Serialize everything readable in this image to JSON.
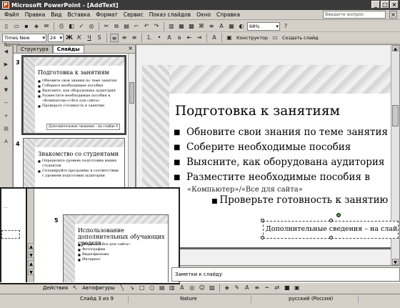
{
  "window": {
    "title": "Microsoft PowerPoint - [AddText]"
  },
  "menu": {
    "items": [
      "Файл",
      "Правка",
      "Вид",
      "Вставка",
      "Формат",
      "Сервис",
      "Показ слайдов",
      "Окно",
      "Справка"
    ],
    "help_placeholder": "Введите вопрос"
  },
  "toolbar_standard": {
    "zoom": "68%"
  },
  "toolbar_format": {
    "font": "Times New Roman",
    "size": "24",
    "designer": "Конструктор",
    "new_slide": "Создать слайд"
  },
  "pane": {
    "tabs": [
      "Структура",
      "Слайды"
    ],
    "active_tab": "Слайды"
  },
  "thumbnails": [
    {
      "num": "3",
      "title": "Подготовка к занятиям",
      "bullets": [
        "Обновите свои знания по теме занятия",
        "Соберите необходимые пособия",
        "Выясните, как оборудована аудитория",
        "Разместите необходимые пособия в «Компьютер»/«Все для сайта»",
        "Проверьте готовность к занятию"
      ],
      "note": "Дополнительные сведения – на слайде 4"
    },
    {
      "num": "4",
      "title": "Знакомство со студентами",
      "bullets": [
        "Определите уровень подготовки ваших студентов",
        "Спланируйте программу в соответствии с уровнем подготовки аудитории"
      ],
      "note": ""
    },
    {
      "num": "5",
      "title": "Использование дополнительных обучающих средств",
      "bullets": [
        "Пособия «Все для сайта»",
        "Фотографии",
        "Видеофильмы",
        "Интернет"
      ],
      "note": ""
    }
  ],
  "slide": {
    "title": "Подготовка к занятиям",
    "bullets": [
      "Обновите свои знания по теме занятия",
      "Соберите необходимые пособия",
      "Выясните, как оборудована аудитория",
      "Разместите необходимые пособия в",
      "«Компьютер»/«Все для сайта»"
    ],
    "sub_bullet": "Проверьте готовность к занятию",
    "textbox": "Дополнительные сведения – на слайде"
  },
  "notes": {
    "placeholder": "Заметки к слайду"
  },
  "drawing": {
    "actions": "Действия",
    "autoshapes": "Автофигуры"
  },
  "status": {
    "slide": "Слайд 3 из 9",
    "design": "Nature",
    "language": "русский (Россия)"
  },
  "colors": {
    "titlebar": "#3a3a3a",
    "chrome": "#d4d0c8"
  }
}
